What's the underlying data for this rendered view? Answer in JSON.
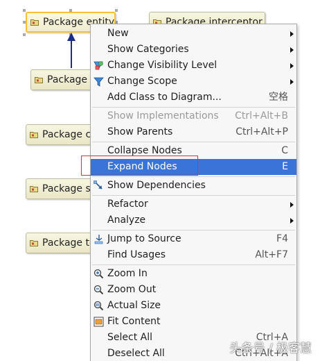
{
  "diagram": {
    "nodes": [
      {
        "label": "Package entity",
        "selected": true
      },
      {
        "label": "Package interceptor",
        "selected": false
      },
      {
        "label": "Package",
        "selected": false
      },
      {
        "label": "Package c",
        "selected": false
      },
      {
        "label": "Package s",
        "selected": false
      },
      {
        "label": "Package te",
        "selected": false
      }
    ],
    "node_color": "#efecd0",
    "selection_color": "#f2c23a",
    "edge_color": "#1a2d8a"
  },
  "context_menu": {
    "items": [
      {
        "label": "New",
        "shortcut": "",
        "submenu": true,
        "icon": ""
      },
      {
        "label": "Show Categories",
        "shortcut": "",
        "submenu": true,
        "icon": ""
      },
      {
        "label": "Change Visibility Level",
        "shortcut": "",
        "submenu": true,
        "icon": "visibility-icon"
      },
      {
        "label": "Change Scope",
        "shortcut": "",
        "submenu": true,
        "icon": "filter-icon"
      },
      {
        "label": "Add Class to Diagram...",
        "shortcut": "空格",
        "submenu": false,
        "icon": ""
      },
      {
        "label": "Show Implementations",
        "shortcut": "Ctrl+Alt+B",
        "submenu": false,
        "icon": "",
        "disabled": true
      },
      {
        "label": "Show Parents",
        "shortcut": "Ctrl+Alt+P",
        "submenu": false,
        "icon": ""
      },
      {
        "label": "Collapse Nodes",
        "shortcut": "C",
        "submenu": false,
        "icon": ""
      },
      {
        "label": "Expand Nodes",
        "shortcut": "E",
        "submenu": false,
        "icon": "",
        "highlighted": true
      },
      {
        "label": "Show Dependencies",
        "shortcut": "",
        "submenu": false,
        "icon": "dependencies-icon"
      },
      {
        "label": "Refactor",
        "shortcut": "",
        "submenu": true,
        "icon": ""
      },
      {
        "label": "Analyze",
        "shortcut": "",
        "submenu": true,
        "icon": ""
      },
      {
        "label": "Jump to Source",
        "shortcut": "F4",
        "submenu": false,
        "icon": "jump-to-source-icon"
      },
      {
        "label": "Find Usages",
        "shortcut": "Alt+F7",
        "submenu": false,
        "icon": ""
      },
      {
        "label": "Zoom In",
        "shortcut": "",
        "submenu": false,
        "icon": "zoom-in-icon"
      },
      {
        "label": "Zoom Out",
        "shortcut": "",
        "submenu": false,
        "icon": "zoom-out-icon"
      },
      {
        "label": "Actual Size",
        "shortcut": "",
        "submenu": false,
        "icon": "actual-size-icon"
      },
      {
        "label": "Fit Content",
        "shortcut": "",
        "submenu": false,
        "icon": "fit-content-icon"
      },
      {
        "label": "Select All",
        "shortcut": "Ctrl+A",
        "submenu": false,
        "icon": ""
      },
      {
        "label": "Deselect All",
        "shortcut": "Ctrl+Alt+A",
        "submenu": false,
        "icon": ""
      }
    ],
    "highlight_color": "#3a74d8",
    "annotation_box_color": "#e03030"
  },
  "watermark": "头条号 / 极客慧"
}
